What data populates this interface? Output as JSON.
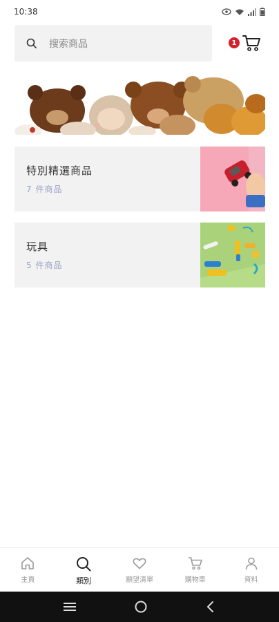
{
  "status_bar": {
    "time": "10:38"
  },
  "search": {
    "placeholder": "搜索商品"
  },
  "cart": {
    "badge_count": "1"
  },
  "categories": [
    {
      "title": "特別精選商品",
      "count": "7 件商品"
    },
    {
      "title": "玩具",
      "count": "5 件商品"
    }
  ],
  "bottom_nav": [
    {
      "label": "主頁",
      "icon": "home-icon",
      "active": false
    },
    {
      "label": "類別",
      "icon": "search-icon",
      "active": true
    },
    {
      "label": "願望清單",
      "icon": "heart-icon",
      "active": false
    },
    {
      "label": "購物車",
      "icon": "cart-icon",
      "active": false
    },
    {
      "label": "資料",
      "icon": "user-icon",
      "active": false
    }
  ],
  "colors": {
    "accent_red": "#d6202c",
    "card_bg": "#f2f2f2",
    "count_text": "#9aa3c7"
  }
}
